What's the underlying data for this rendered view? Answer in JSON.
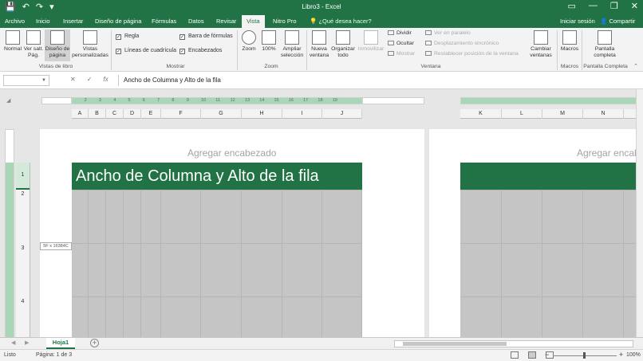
{
  "titlebar": {
    "title": "Libro3 - Excel",
    "qat": {
      "save_icon": "save-icon",
      "undo_icon": "undo-icon",
      "redo_icon": "redo-icon",
      "customize_icon": "customize-icon"
    },
    "window_buttons": {
      "ribbon_display": "▭",
      "minimize": "—",
      "restore": "❐",
      "close": "✕"
    }
  },
  "tabs": [
    {
      "label": "Archivo"
    },
    {
      "label": "Inicio"
    },
    {
      "label": "Insertar"
    },
    {
      "label": "Diseño de página"
    },
    {
      "label": "Fórmulas"
    },
    {
      "label": "Datos"
    },
    {
      "label": "Revisar"
    },
    {
      "label": "Vista"
    },
    {
      "label": "Nitro Pro"
    }
  ],
  "active_tab": "Vista",
  "tellme": "¿Qué desea hacer?",
  "signin": "Iniciar sesión",
  "share": "Compartir",
  "ribbon": {
    "workbook_views": {
      "group_label": "Vistas de libro",
      "normal": "Normal",
      "page_break": "Ver salt. Pág.",
      "page_layout": "Diseño de página",
      "custom_views": "Vistas personalizadas"
    },
    "show": {
      "group_label": "Mostrar",
      "ruler": "Regla",
      "formula_bar": "Barra de fórmulas",
      "gridlines": "Líneas de cuadrícula",
      "headings": "Encabezados"
    },
    "zoom": {
      "group_label": "Zoom",
      "zoom": "Zoom",
      "hundred": "100%",
      "zoom_selection": "Ampliar selección"
    },
    "window": {
      "group_label": "Ventana",
      "new_window": "Nueva ventana",
      "arrange_all": "Organizar todo",
      "freeze": "Inmovilizar",
      "split": "Dividir",
      "hide": "Ocultar",
      "unhide": "Mostrar",
      "side_by_side": "Ver en paralelo",
      "sync_scroll": "Desplazamiento sincrónico",
      "reset_position": "Restablecer posición de la ventana",
      "switch_windows": "Cambiar ventanas"
    },
    "macros": {
      "group_label": "Macros",
      "macros": "Macros"
    },
    "fullscreen": {
      "group_label": "Pantalla Completa",
      "label": "Pantalla completa"
    }
  },
  "formula_bar": {
    "cancel_icon": "✕",
    "enter_icon": "✓",
    "fx": "fx",
    "value": "Ancho de Columna y Alto de la fila"
  },
  "ruler": {
    "numbers": [
      "1",
      "1",
      "2",
      "3",
      "4",
      "5",
      "6",
      "7",
      "8",
      "9",
      "10",
      "11",
      "12",
      "13",
      "14",
      "15",
      "16",
      "17",
      "18",
      "19"
    ]
  },
  "columns_page1": [
    "A",
    "B",
    "C",
    "D",
    "E",
    "F",
    "G",
    "H",
    "I",
    "J"
  ],
  "columns_page2": [
    "K",
    "L",
    "M",
    "N"
  ],
  "rows": [
    "1",
    "2",
    "3",
    "4"
  ],
  "header_placeholder": "Agregar encabezado",
  "size_tooltip": "5F x 16384C",
  "cell_A1": "Ancho de Columna y Alto de la fila",
  "sheets": [
    {
      "name": "Hoja1"
    }
  ],
  "status": {
    "ready": "Listo",
    "page": "Página: 1 de 3",
    "zoom": "100%",
    "zoom_minus": "−",
    "zoom_plus": "+"
  },
  "colors": {
    "accent": "#217346",
    "banner": "#217346",
    "gray_fill": "#c5c5c5"
  }
}
